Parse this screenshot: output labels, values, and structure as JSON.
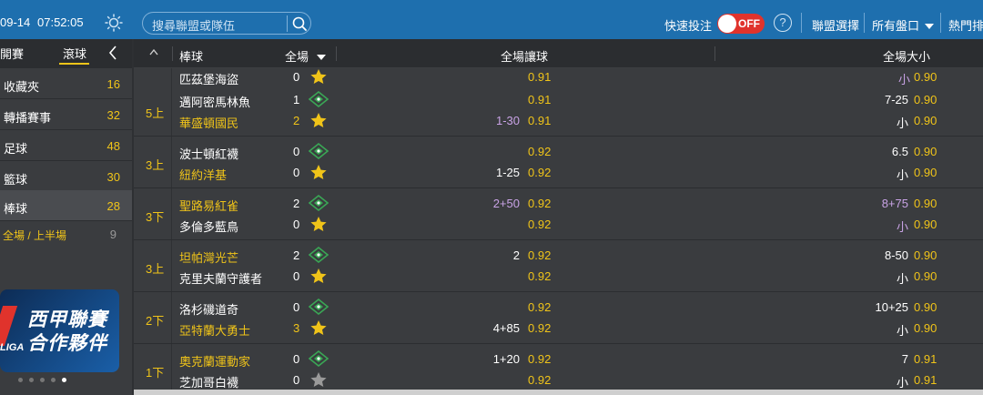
{
  "topbar": {
    "date": "09-14",
    "time": "07:52:05",
    "search_placeholder": "搜尋聯盟或隊伍",
    "quick_bet_label": "快速投注",
    "toggle_label": "OFF",
    "help_label": "?",
    "league_select": "聯盟選擇",
    "all_markets": "所有盤口",
    "hot_label": "熱門排序"
  },
  "sidebar": {
    "tab_early": "開賽",
    "tab_live": "滾球",
    "items": [
      {
        "label": "收藏夾",
        "count": "16"
      },
      {
        "label": "轉播賽事",
        "count": "32"
      },
      {
        "label": "足球",
        "count": "48"
      },
      {
        "label": "籃球",
        "count": "30"
      },
      {
        "label": "棒球",
        "count": "28"
      }
    ],
    "half_label": "全場 / 上半場",
    "half_count": "9",
    "banner_line1": "西甲聯賽",
    "banner_line2": "合作夥伴",
    "banner_tag": "LIGA"
  },
  "header": {
    "sport": "棒球",
    "period": "全場",
    "handicap": "全場讓球",
    "total": "全場大小"
  },
  "partial_row": {
    "team": "匹茲堡海盜",
    "score": "0",
    "odd": "0.91",
    "ou_label": "小",
    "ou_odd": "0.90"
  },
  "matches": [
    {
      "inning": "5上",
      "home": {
        "name": "邁阿密馬林魚",
        "score": "1",
        "hcp": "",
        "hodd": "0.91",
        "ou": "7-25",
        "ouodd": "0.90"
      },
      "away": {
        "name": "華盛頓國民",
        "score": "2",
        "hcp": "1-30",
        "hodd": "0.91",
        "ou": "小",
        "ouodd": "0.90"
      }
    },
    {
      "inning": "3上",
      "home": {
        "name": "波士頓紅襪",
        "score": "0",
        "hcp": "",
        "hodd": "0.92",
        "ou": "6.5",
        "ouodd": "0.90"
      },
      "away": {
        "name": "紐約洋基",
        "score": "0",
        "hcp": "1-25",
        "hodd": "0.92",
        "ou": "小",
        "ouodd": "0.90"
      }
    },
    {
      "inning": "3下",
      "home": {
        "name": "聖路易紅雀",
        "score": "2",
        "hcp": "2+50",
        "hodd": "0.92",
        "ou": "8+75",
        "ouodd": "0.90"
      },
      "away": {
        "name": "多倫多藍鳥",
        "score": "0",
        "hcp": "",
        "hodd": "0.92",
        "ou": "小",
        "ouodd": "0.90"
      }
    },
    {
      "inning": "3上",
      "home": {
        "name": "坦帕灣光芒",
        "score": "2",
        "hcp": "2",
        "hodd": "0.92",
        "ou": "8-50",
        "ouodd": "0.90"
      },
      "away": {
        "name": "克里夫蘭守護者",
        "score": "0",
        "hcp": "",
        "hodd": "0.92",
        "ou": "小",
        "ouodd": "0.90"
      }
    },
    {
      "inning": "2下",
      "home": {
        "name": "洛杉磯道奇",
        "score": "0",
        "hcp": "",
        "hodd": "0.92",
        "ou": "10+25",
        "ouodd": "0.90"
      },
      "away": {
        "name": "亞特蘭大勇士",
        "score": "3",
        "hcp": "4+85",
        "hodd": "0.92",
        "ou": "小",
        "ouodd": "0.90"
      }
    },
    {
      "inning": "1下",
      "home": {
        "name": "奧克蘭運動家",
        "score": "0",
        "hcp": "1+20",
        "hodd": "0.92",
        "ou": "7",
        "ouodd": "0.91"
      },
      "away": {
        "name": "芝加哥白襪",
        "score": "0",
        "hcp": "",
        "hodd": "0.92",
        "ou": "小",
        "ouodd": "0.91"
      }
    }
  ],
  "colors": {
    "topbar": "#1e6fae",
    "accent_yellow": "#f0c419",
    "purple": "#c9a3e6",
    "toggle_red": "#e0332c",
    "field_green": "#3aa655"
  }
}
